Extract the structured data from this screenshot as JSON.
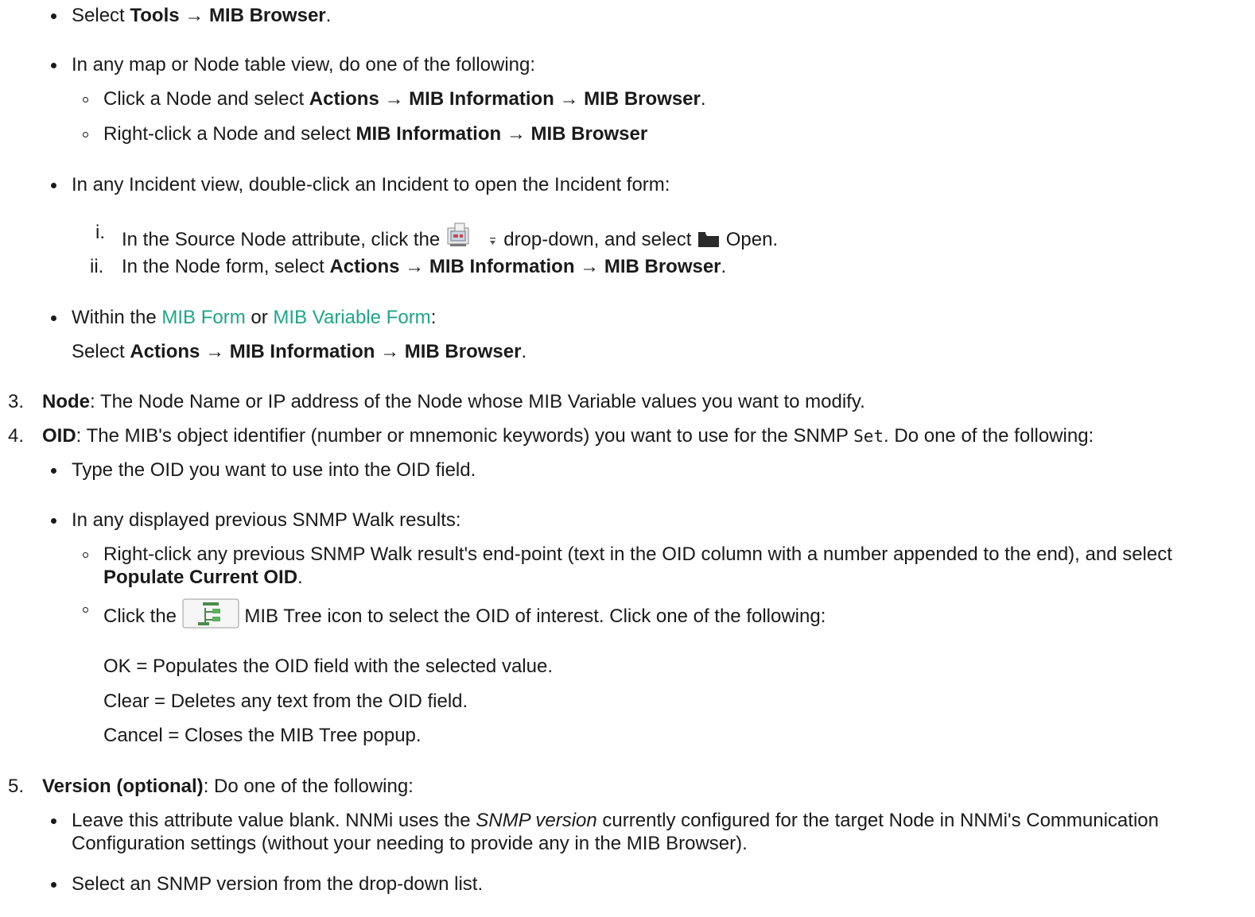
{
  "arrow": "→",
  "items": {
    "tools": {
      "pre": "Select ",
      "b1": "Tools",
      "b2": "MIB Browser",
      "post": "."
    },
    "map_view": {
      "text": "In any map or Node table view, do one of the following:"
    },
    "click_node": {
      "pre": "Click a Node and select ",
      "b1": "Actions",
      "b2": "MIB Information",
      "b3": "MIB Browser",
      "post": "."
    },
    "right_click_node": {
      "pre": "Right-click a Node and select ",
      "b1": "MIB Information",
      "b2": "MIB Browser"
    },
    "incident_view": {
      "text": "In any Incident view, double-click an Incident to open the Incident form:"
    },
    "step_i": {
      "marker": "i.",
      "pre": "In the Source Node attribute, click the",
      "mid": "drop-down, and select",
      "post": "Open."
    },
    "step_ii": {
      "marker": "ii.",
      "pre": "In the Node form, select ",
      "b1": "Actions",
      "b2": "MIB Information",
      "b3": "MIB Browser",
      "post": "."
    },
    "within_forms": {
      "pre": "Within the ",
      "link1": "MIB Form",
      "mid": " or ",
      "link2": "MIB Variable Form",
      "post": ":"
    },
    "select_actions": {
      "pre": "Select ",
      "b1": "Actions",
      "b2": "MIB Information",
      "b3": "MIB Browser",
      "post": "."
    }
  },
  "numbered": {
    "n3": {
      "num": "3.",
      "label": "Node",
      "text": ": The Node Name or IP address of the Node whose MIB Variable values you want to modify."
    },
    "n4": {
      "num": "4.",
      "label": "OID",
      "pre": ": The MIB's object identifier (number or mnemonic keywords) you want to use for the SNMP ",
      "code": "Set",
      "post": ". Do one of the following:"
    },
    "n5": {
      "num": "5.",
      "label": "Version (optional)",
      "text": ": Do one of the following:"
    }
  },
  "oid": {
    "type_oid": "Type the OID you want to use into the OID field.",
    "walk_results": "In any displayed previous SNMP Walk results:",
    "right_click_walk": "Right-click any previous SNMP Walk result's end-point (text in the OID column with a number appended to the end), and select",
    "populate": "Populate Current OID",
    "populate_post": ".",
    "click_the": "Click the",
    "mib_tree_text": "MIB Tree icon to select the OID of interest. Click one of the following:",
    "ok": "OK = Populates the OID field with the selected value.",
    "clear": "Clear = Deletes any text from the OID field.",
    "cancel": "Cancel = Closes the MIB Tree popup."
  },
  "version": {
    "leave_pre": "Leave this attribute value blank. NNMi uses the ",
    "leave_em": "SNMP version",
    "leave_post": " currently configured for the target Node in NNMi's Communication",
    "leave_line2": "Configuration settings (without your needing to provide any in the MIB Browser).",
    "select_snmp": "Select an SNMP version from the drop-down list."
  },
  "icons": {
    "source_node": "node-lookup-icon",
    "dropdown": "dropdown-arrow-icon",
    "folder": "folder-icon",
    "mib_tree": "mib-tree-icon"
  },
  "colors": {
    "link": "#1fa58a",
    "text": "#1a1a1a"
  }
}
